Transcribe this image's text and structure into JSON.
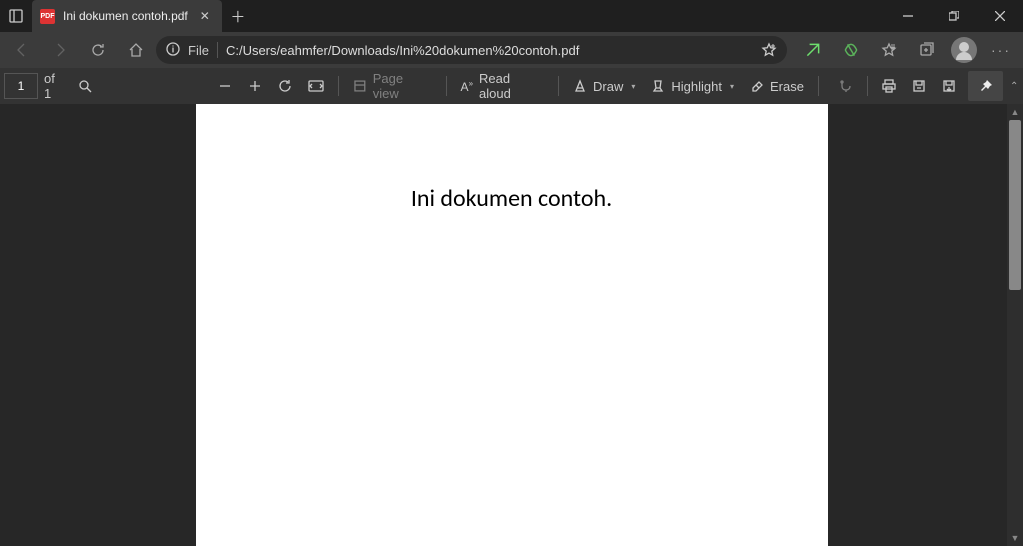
{
  "tab": {
    "title": "Ini dokumen contoh.pdf"
  },
  "url": {
    "scheme": "File",
    "path": "C:/Users/eahmfer/Downloads/Ini%20dokumen%20contoh.pdf"
  },
  "pdfbar": {
    "page_value": "1",
    "page_total": "of 1",
    "page_view": "Page view",
    "read_aloud": "Read aloud",
    "draw": "Draw",
    "highlight": "Highlight",
    "erase": "Erase"
  },
  "document": {
    "heading": "Ini dokumen contoh."
  }
}
